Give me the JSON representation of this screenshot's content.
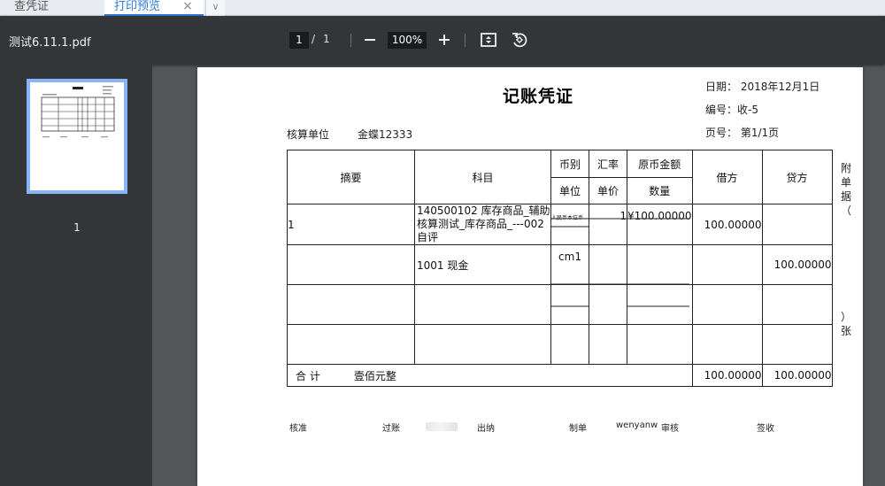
{
  "tabs": [
    {
      "label": "查凭证"
    },
    {
      "label": "打印预览"
    }
  ],
  "tab_close": "×",
  "tab_more": "∨",
  "viewer": {
    "file_name": "测试6.11.1.pdf",
    "page_current": "1",
    "page_sep": "/",
    "page_total": "1",
    "zoom": "100%",
    "thumb_label": "1"
  },
  "icons": {
    "zoom_out": "minus-icon",
    "zoom_in": "plus-icon",
    "fit": "fit-page-icon",
    "rotate": "rotate-icon"
  },
  "voucher": {
    "title": "记账凭证",
    "date_label": "日期：",
    "date_value": "2018年12月1日",
    "no_label": "编号：",
    "no_value": "收-5",
    "page_label": "页号：",
    "page_value": "第1/1页",
    "unit_label": "核算单位",
    "unit_value": "金蝶12333",
    "headers": {
      "summary": "摘要",
      "account": "科目",
      "currency": "币别",
      "rate": "汇率",
      "orig_amount": "原币金额",
      "unit": "单位",
      "price": "单价",
      "qty": "数量",
      "debit": "借方",
      "credit": "贷方"
    },
    "rows": [
      {
        "summary": "1",
        "account": "140500102 库存商品_辅助核算测试_库存商品_---002 自评",
        "currency": "人民币本位币",
        "rate": "1",
        "orig_amount": "¥100.00000",
        "debit": "100.00000",
        "credit": ""
      },
      {
        "summary": "",
        "account": "1001 现金",
        "currency": "cm1",
        "rate": "",
        "orig_amount": "",
        "debit": "",
        "credit": "100.00000"
      }
    ],
    "total_label": "合 计",
    "total_words": "壹佰元整",
    "total_debit": "100.00000",
    "total_credit": "100.00000",
    "attach_top": "附单据（",
    "attach_bottom": "）张",
    "footer": {
      "approve": "核准",
      "post": "过账",
      "cashier": "出纳",
      "maker": "制单",
      "maker_name": "wenyanw",
      "audit": "审核",
      "sign": "签收"
    }
  }
}
